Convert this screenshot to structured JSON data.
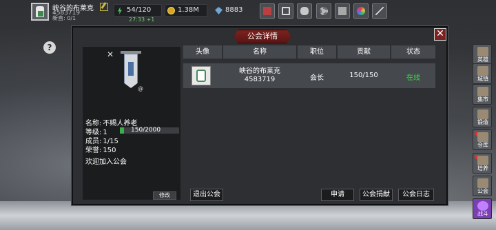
{
  "player": {
    "name": "峡谷的布莱克",
    "id": "4583719",
    "sub": "新直: 0/1"
  },
  "resources": {
    "energy": "54/120",
    "energy_timer": "27:33 +1",
    "gold": "1.38M",
    "gems": "8883"
  },
  "side_menu": [
    {
      "label": "英雄"
    },
    {
      "label": "城镇"
    },
    {
      "label": "集市"
    },
    {
      "label": "锻造"
    },
    {
      "label": "仓库"
    },
    {
      "label": "培养"
    },
    {
      "label": "公会"
    },
    {
      "label": "战斗"
    }
  ],
  "modal": {
    "title": "公会详情",
    "close": "✕"
  },
  "guild": {
    "name_label": "名称:",
    "name": "不赐人养老",
    "level_label": "等级:",
    "level": "1",
    "exp": "150/2000",
    "exp_fraction": 0.075,
    "members_label": "成员:",
    "members": "1/15",
    "honor_label": "荣誉:",
    "honor": "150",
    "welcome": "欢迎加入公会",
    "modify": "修改"
  },
  "table": {
    "headers": [
      "头像",
      "名称",
      "职位",
      "贡献",
      "状态"
    ],
    "rows": [
      {
        "name": "峡谷的布莱克",
        "id": "4583719",
        "position": "会长",
        "contribution": "150/150",
        "status": "在线"
      }
    ]
  },
  "buttons": {
    "quit": "退出公会",
    "apply": "申请",
    "donate": "公会捐献",
    "log": "公会日志"
  },
  "colors": {
    "online": "#3ad94a",
    "title_bar": "#7a2220"
  }
}
